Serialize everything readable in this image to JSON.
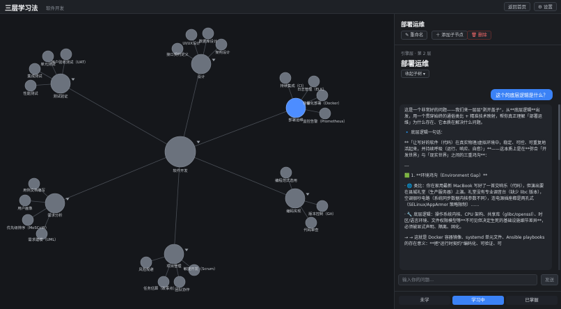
{
  "header": {
    "title": "三层学习法",
    "subtitle": "软件开发",
    "back_label": "返回首页",
    "settings_label": "⚙ 设置"
  },
  "graph": {
    "accent": "#4d8dff",
    "node_color": "#6b727d",
    "line_color": "#4a4f57",
    "nodes": [
      {
        "id": "root",
        "label": "软件开发"
      },
      {
        "id": "design",
        "label": "设计"
      },
      {
        "id": "uiux",
        "label": "UI/UX设计"
      },
      {
        "id": "db",
        "label": "数据库设计"
      },
      {
        "id": "arch",
        "label": "架构设计"
      },
      {
        "id": "api",
        "label": "接口契约定义"
      },
      {
        "id": "test",
        "label": "测试验证"
      },
      {
        "id": "unit",
        "label": "单元测试"
      },
      {
        "id": "uat",
        "label": "用户验收测试（UAT）"
      },
      {
        "id": "integ",
        "label": "集成测试"
      },
      {
        "id": "perf",
        "label": "性能测试"
      },
      {
        "id": "deploy",
        "label": "部署运维"
      },
      {
        "id": "ci",
        "label": "持续集成（CI）"
      },
      {
        "id": "log",
        "label": "日志管理（ELK）"
      },
      {
        "id": "docker",
        "label": "容器化部署（Docker）"
      },
      {
        "id": "prom",
        "label": "监控告警（Prometheus）"
      },
      {
        "id": "coding",
        "label": "编码实现"
      },
      {
        "id": "style",
        "label": "编程范式选用"
      },
      {
        "id": "git",
        "label": "版本控制（Git）"
      },
      {
        "id": "review",
        "label": "代码审查"
      },
      {
        "id": "req",
        "label": "需求分析"
      },
      {
        "id": "usecase",
        "label": "用例文档编写"
      },
      {
        "id": "persona",
        "label": "用户画像"
      },
      {
        "id": "moscow",
        "label": "优先级排序（MoSCoW）"
      },
      {
        "id": "uml",
        "label": "需求建模（UML）"
      },
      {
        "id": "pm",
        "label": "项目管理"
      },
      {
        "id": "risk",
        "label": "风险规避"
      },
      {
        "id": "scrum",
        "label": "敏捷开发（Scrum）"
      },
      {
        "id": "estimate",
        "label": "任务估算（故事点）"
      },
      {
        "id": "collab",
        "label": "团队协作"
      }
    ]
  },
  "panel": {
    "title": "部署运维",
    "rename_label": "✎ 重命名",
    "add_child_label": "＋ 添加子节点",
    "delete_label": "🗑 删除",
    "breadcrumb": "引擎层 · 第 2 层",
    "node_title": "部署运维",
    "collapse_label": "收起子树 ▾",
    "user_question": "这个的底层逻辑是什么？",
    "ai_paragraphs": [
      "这是一个非常好的问题——我们来一层层\"剥开盖子\"，从**底层逻辑**出发，用一个贯穿始终的通俗类比 + 精准技术映射，帮你真正理解「部署运维」为什么存在、它本质在解决什么问题。",
      "🔹 底层逻辑一句话：",
      "**「让写好的软件（代码）在真实物理/虚拟环境中，稳定、可控、可重复地活起来，并持续呼吸（运行、响应、自愈）」**——这本质上是在**弥合「开发世界」与「现实世界」之间的三重鸿沟**：",
      "---",
      "🟩 1. **环境鸿沟（Environment Gap）**",
      "· 🌐 类比：你在家用最新 MacBook 写好了一首交响乐（代码），但演出要在县城礼堂（生产服务器）上演。礼堂没有专业调音台（缺少 libc 版本），空调很吵电路（系统同步数据内核参数不同），连电源插座都是两孔式（SELinux/AppArmor 策略限制）……",
      "· 🔧 底层逻辑：操作系统内核、CPU 架构、共享库（glibc/openssl）、时区/语言环境、文件权限模型等**不可见但决定生死的基础设施细节差异**，必须被显式声明、隔离、固化。",
      "→ → 这就是 Docker 容器镜像、systemd 单元文件、Ansible playbooks 的存在意义：**把\"运行时契约\"编码化、可验证、可"
    ],
    "input_placeholder": "输入你的问题...",
    "send_label": "发送",
    "status": {
      "todo": "未学",
      "learning": "学习中",
      "mastered": "已掌握"
    }
  }
}
